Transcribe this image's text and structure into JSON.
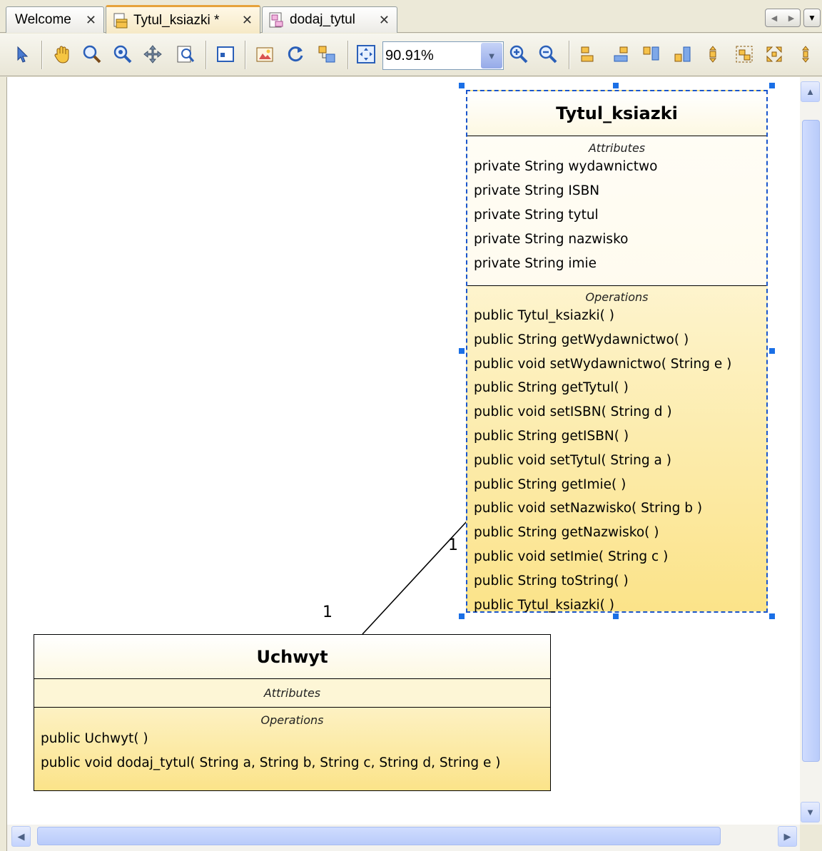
{
  "tabs": [
    {
      "label": "Welcome",
      "icon": "none"
    },
    {
      "label": "Tytul_ksiazki *",
      "icon": "class-diagram-icon"
    },
    {
      "label": "dodaj_tytul",
      "icon": "sequence-diagram-icon"
    }
  ],
  "tab_close_glyph": "✕",
  "toolbar": {
    "zoom_value": "90.91%"
  },
  "classes": {
    "tytul": {
      "name": "Tytul_ksiazki",
      "attributes_title": "Attributes",
      "attributes": [
        "private String wydawnictwo",
        "private String ISBN",
        "private String tytul",
        "private String nazwisko",
        "private String imie"
      ],
      "operations_title": "Operations",
      "operations": [
        "public Tytul_ksiazki(  )",
        "public String  getWydawnictwo(  )",
        "public void  setWydawnictwo( String e )",
        "public String  getTytul(  )",
        "public void  setISBN( String d )",
        "public String  getISBN(  )",
        "public void  setTytul( String a )",
        "public String  getImie(  )",
        "public void  setNazwisko( String b )",
        "public String  getNazwisko(  )",
        "public void  setImie( String c )",
        "public String  toString(  )",
        "public Tytul_ksiazki(  )"
      ]
    },
    "uchwyt": {
      "name": "Uchwyt",
      "attributes_title": "Attributes",
      "operations_title": "Operations",
      "operations": [
        "public Uchwyt(  )",
        "public void  dodaj_tytul( String a, String b, String c, String d, String e )"
      ]
    }
  },
  "association": {
    "mult_tytul": "1",
    "mult_uchwyt": "1"
  },
  "colors": {
    "selection": "#1a55cc",
    "class_fill_bottom": "#fbe389",
    "active_tab_accent": "#e6a23c"
  }
}
